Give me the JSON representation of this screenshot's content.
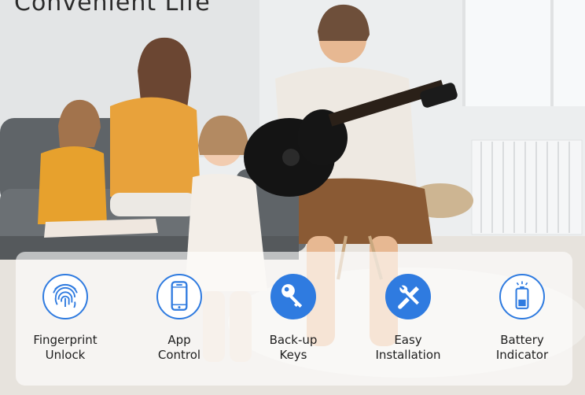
{
  "headline": "Convenient Life",
  "features": [
    {
      "line1": "Fingerprint",
      "line2": "Unlock",
      "icon": "fingerprint-icon"
    },
    {
      "line1": "App",
      "line2": "Control",
      "icon": "smartphone-icon"
    },
    {
      "line1": "Back-up",
      "line2": "Keys",
      "icon": "key-icon"
    },
    {
      "line1": "Easy",
      "line2": "Installation",
      "icon": "tools-icon"
    },
    {
      "line1": "Battery",
      "line2": "Indicator",
      "icon": "battery-icon"
    }
  ],
  "colors": {
    "accent": "#2f7be0",
    "text": "#1e1e1e"
  }
}
